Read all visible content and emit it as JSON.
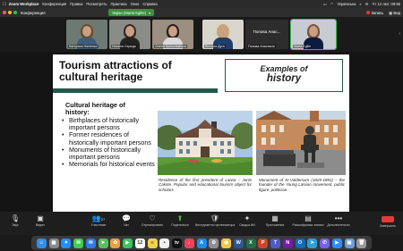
{
  "menubar": {
    "apple": "",
    "app_name": "Zoom Workplace",
    "items": [
      "Конференция",
      "Правка",
      "Посмотреть",
      "Практика",
      "Окно",
      "Справка"
    ],
    "keyboard": "Українська",
    "datetime": "Чт 12 лют. 08:55"
  },
  "titlebar": {
    "window_title": "Конференция",
    "share_label": "Экран (Marta Eglite)",
    "recording_label": "Запись",
    "view_label": "Вид"
  },
  "participants": [
    {
      "name": "Катерина Нікітенко",
      "hair": "#6a4a30",
      "torso": "#3b5c7a",
      "bg": "#6d7a73"
    },
    {
      "name": "Наталія Середа",
      "hair": "#3a2a20",
      "torso": "#222222",
      "bg": "#8a8c88"
    },
    {
      "name": "Олена Крохолевська",
      "hair": "#2a1d18",
      "torso": "#d9d9d9",
      "bg": "#9a8f80"
    },
    {
      "name": "Вікторія Дуга",
      "hair": "#c9a86a",
      "torso": "#1f3c6a",
      "bg": "#d8d5cc"
    },
    {
      "name": "Попова Анастасія",
      "big": "Попова Анас...",
      "text_only": true
    },
    {
      "name": "Marta Eglite",
      "hair": "#7a5438",
      "torso": "#0c1c40",
      "bg": "#c7ccd2",
      "speaking": true
    }
  ],
  "slide": {
    "title_line1": "Tourism attractions of",
    "title_line2": "cultural heritage",
    "examples_line1": "Examples of",
    "examples_line2": "history",
    "heading_line1": "Cultural heritage of",
    "heading_line2": "history:",
    "bullets": [
      "Birthplaces of historically important persons",
      "Former residences of historically important persons",
      "Monuments of historically important persons",
      "Memorials for historical events"
    ],
    "caption1": "Residence of the first president of Latvia – Janis Cakste. Popular and educational tourism object for scholars.",
    "caption2": "Monument of Kr.Valdemars (1825-1891) – the founder of the Young Latvian movement, public figure, politician."
  },
  "toolbar": {
    "buttons": [
      {
        "label": "Звук",
        "icon": "mic-icon"
      },
      {
        "label": "Видео",
        "icon": "video-icon"
      },
      {
        "label": "Участники",
        "icon": "participants-icon",
        "count": "27"
      },
      {
        "label": "Чат",
        "icon": "chat-icon"
      },
      {
        "label": "Отреагировать",
        "icon": "react-icon"
      },
      {
        "label": "Поделиться",
        "icon": "share-icon"
      },
      {
        "label": "Инструменты организатора",
        "icon": "host-tools-icon"
      },
      {
        "label": "Сводка ИИ",
        "icon": "ai-summary-icon"
      },
      {
        "label": "Приложения",
        "icon": "apps-icon"
      },
      {
        "label": "Расшифровка записи",
        "icon": "transcript-icon"
      },
      {
        "label": "Дополнительно",
        "icon": "more-icon"
      }
    ],
    "end_label": "Завершить"
  },
  "dock": {
    "icons": [
      {
        "name": "finder-icon",
        "color": "#2f8fe8",
        "glyph": "☺"
      },
      {
        "name": "launchpad-icon",
        "color": "#8a8a8a",
        "glyph": "▦"
      },
      {
        "name": "safari-icon",
        "color": "#1e90ff",
        "glyph": "✦"
      },
      {
        "name": "messages-icon",
        "color": "#3ccf4e",
        "glyph": "✉"
      },
      {
        "name": "mail-icon",
        "color": "#2f7be8",
        "glyph": "✉"
      },
      {
        "name": "maps-icon",
        "color": "#5bbf5b",
        "glyph": "➤"
      },
      {
        "name": "photos-icon",
        "color": "#e8a040",
        "glyph": "✿"
      },
      {
        "name": "facetime-icon",
        "color": "#34c759",
        "glyph": "▶"
      },
      {
        "name": "calendar-icon",
        "color": "#ffffff",
        "glyph": "12"
      },
      {
        "name": "notes-icon",
        "color": "#f2d24a",
        "glyph": "≡"
      },
      {
        "name": "reminders-icon",
        "color": "#f0f0f0",
        "glyph": "•"
      },
      {
        "name": "appletv-icon",
        "color": "#111111",
        "glyph": "tv"
      },
      {
        "name": "music-icon",
        "color": "#f2405a",
        "glyph": "♪"
      },
      {
        "name": "appstore-icon",
        "color": "#1d8cf8",
        "glyph": "A"
      },
      {
        "name": "settings-icon",
        "color": "#8e8e93",
        "glyph": "⚙"
      },
      {
        "name": "chrome-icon",
        "color": "#f2c84b",
        "glyph": "◉"
      },
      {
        "name": "word-icon",
        "color": "#2b5797",
        "glyph": "W"
      },
      {
        "name": "excel-icon",
        "color": "#1d7044",
        "glyph": "X"
      },
      {
        "name": "powerpoint-icon",
        "color": "#d04423",
        "glyph": "P"
      },
      {
        "name": "teams-icon",
        "color": "#5059c9",
        "glyph": "T"
      },
      {
        "name": "onenote-icon",
        "color": "#7719aa",
        "glyph": "N"
      },
      {
        "name": "outlook-icon",
        "color": "#0f6cbd",
        "glyph": "O"
      },
      {
        "name": "telegram-icon",
        "color": "#2aa1da",
        "glyph": "➤"
      },
      {
        "name": "viber-icon",
        "color": "#7360f2",
        "glyph": "✆"
      },
      {
        "name": "zoom-icon",
        "color": "#2d8cff",
        "glyph": "▶"
      },
      {
        "name": "preview-icon",
        "color": "#6a9fd8",
        "glyph": "▣"
      },
      {
        "name": "trash-icon",
        "color": "#9a9a9a",
        "glyph": "🗑"
      }
    ]
  }
}
